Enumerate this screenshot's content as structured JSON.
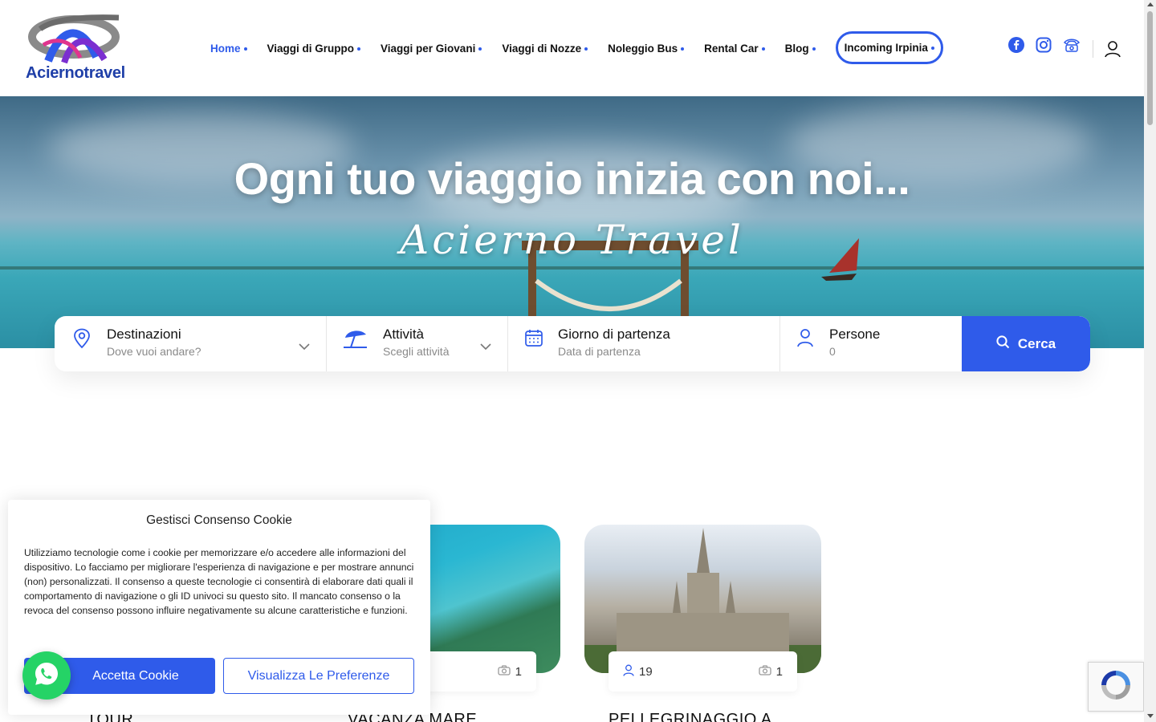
{
  "brand": {
    "name": "Aciernotravel"
  },
  "nav": {
    "items": [
      {
        "label": "Home",
        "active": true
      },
      {
        "label": "Viaggi di Gruppo"
      },
      {
        "label": "Viaggi per Giovani"
      },
      {
        "label": "Viaggi di Nozze"
      },
      {
        "label": "Noleggio Bus"
      },
      {
        "label": "Rental Car"
      },
      {
        "label": "Blog"
      },
      {
        "label": "Incoming Irpinia",
        "highlight": true
      }
    ],
    "social_icons": [
      "facebook-icon",
      "instagram-icon",
      "phone-icon"
    ],
    "user_icon": "user-icon"
  },
  "hero": {
    "title": "Ogni tuo viaggio inizia con noi...",
    "subtitle": "Acierno Travel"
  },
  "search": {
    "fields": [
      {
        "label": "Destinazioni",
        "placeholder": "Dove vuoi andare?",
        "icon": "map-pin-icon"
      },
      {
        "label": "Attività",
        "placeholder": "Scegli attività",
        "icon": "beach-umbrella-icon"
      },
      {
        "label": "Giorno di partenza",
        "placeholder": "Data di partenza",
        "icon": "calendar-icon"
      },
      {
        "label": "Persone",
        "placeholder": "0",
        "icon": "person-icon"
      }
    ],
    "button_label": "Cerca"
  },
  "cards": [
    {
      "title": "TOUR"
    },
    {
      "title": "VACANZA MARE",
      "photos": "1"
    },
    {
      "title": "PELLEGRINAGGIO A",
      "people": "19",
      "photos": "1"
    }
  ],
  "cookie": {
    "title": "Gestisci Consenso Cookie",
    "text": "Utilizziamo tecnologie come i cookie per memorizzare e/o accedere alle informazioni del dispositivo. Lo facciamo per migliorare l'esperienza di navigazione e per mostrare annunci (non) personalizzati. Il consenso a queste tecnologie ci consentirà di elaborare dati quali il comportamento di navigazione o gli ID univoci su questo sito. Il mancato consenso o la revoca del consenso possono influire negativamente su alcune caratteristiche e funzioni.",
    "accept_label": "Accetta Cookie",
    "prefs_label": "Visualizza Le Preferenze"
  },
  "colors": {
    "accent": "#2f5bea",
    "whatsapp": "#25d366"
  }
}
